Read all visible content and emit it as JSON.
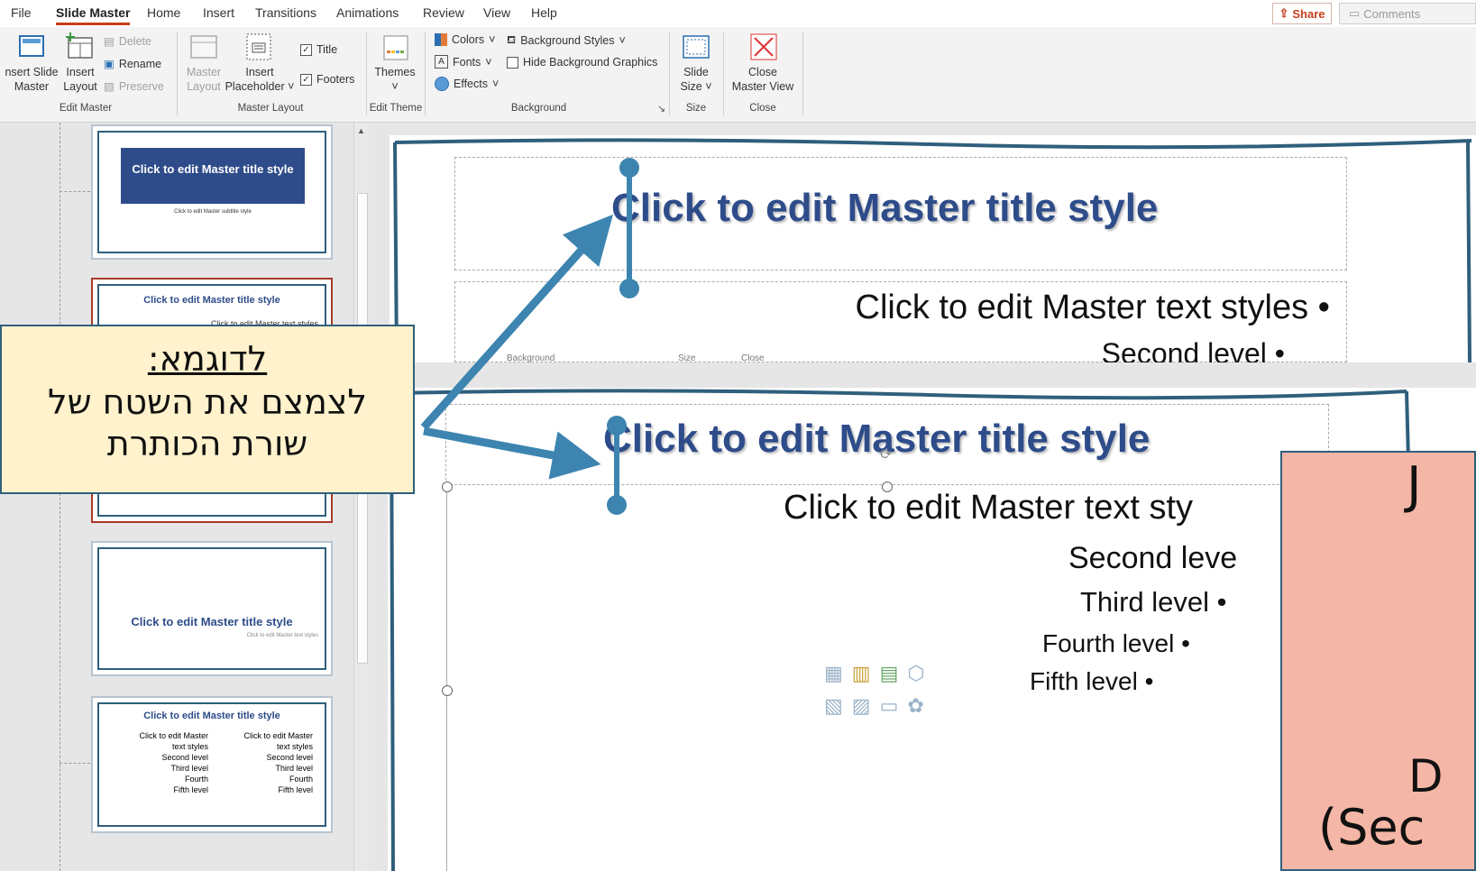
{
  "menu": {
    "items": [
      "File",
      "Slide Master",
      "Home",
      "Insert",
      "Transitions",
      "Animations",
      "Review",
      "View",
      "Help"
    ],
    "share": "Share",
    "comments": "Comments"
  },
  "ribbon": {
    "insert_slide_master": [
      "nsert Slide",
      "Master"
    ],
    "insert_layout": [
      "Insert",
      "Layout"
    ],
    "delete": "Delete",
    "rename": "Rename",
    "preserve": "Preserve",
    "group_edit_master": "Edit Master",
    "master_layout": [
      "Master",
      "Layout"
    ],
    "insert_placeholder": [
      "Insert",
      "Placeholder"
    ],
    "title_check": "Title",
    "footers_check": "Footers",
    "group_master_layout": "Master Layout",
    "themes": "Themes",
    "group_edit_theme": "Edit Theme",
    "colors": "Colors",
    "fonts": "Fonts",
    "effects": "Effects",
    "background_styles": "Background Styles",
    "hide_background_graphics": "Hide Background Graphics",
    "group_background": "Background",
    "slide_size": [
      "Slide",
      "Size"
    ],
    "group_size": "Size",
    "close_master_view": [
      "Close",
      "Master View"
    ],
    "group_close": "Close"
  },
  "thumbnails": {
    "t1_title": "Click to edit Master title style",
    "t1_subtitle": "Click to edit Master subtitle style",
    "t2_title": "Click to edit Master title style",
    "t2_text": "Click to edit Master text styles",
    "t3_title": "Click to edit Master title style",
    "t3_text": "Click to edit Master text styles",
    "t4_title": "Click to edit Master title style",
    "t4_col": [
      "Click to edit Master",
      "text styles",
      "Second level",
      "Third level",
      "Fourth",
      "Fifth level"
    ]
  },
  "slide_top": {
    "title": "Click to edit Master title style",
    "text": "Click to edit Master text styles",
    "second": "Second level",
    "ribbon_ghost": [
      "Background",
      "Size",
      "Close"
    ]
  },
  "slide_bottom": {
    "title": "Click to edit Master title style",
    "text": "Click to edit Master text sty",
    "second": "Second leve",
    "third": "Third level",
    "fourth": "Fourth level",
    "fifth": "Fifth level"
  },
  "callout": {
    "heading": "לדוגמא:",
    "line1": "לצמצם את השטח של",
    "line2": "שורת הכותרת"
  },
  "callout_right": {
    "frag1": "J",
    "frag2": "D",
    "frag3": "(Sec"
  },
  "colors": {
    "accent_red": "#c43e1c",
    "title_blue": "#2e4c8a",
    "arrow_blue": "#3d85b0",
    "callout_yellow": "#fff2cc",
    "callout_red": "#f4b6a6"
  }
}
